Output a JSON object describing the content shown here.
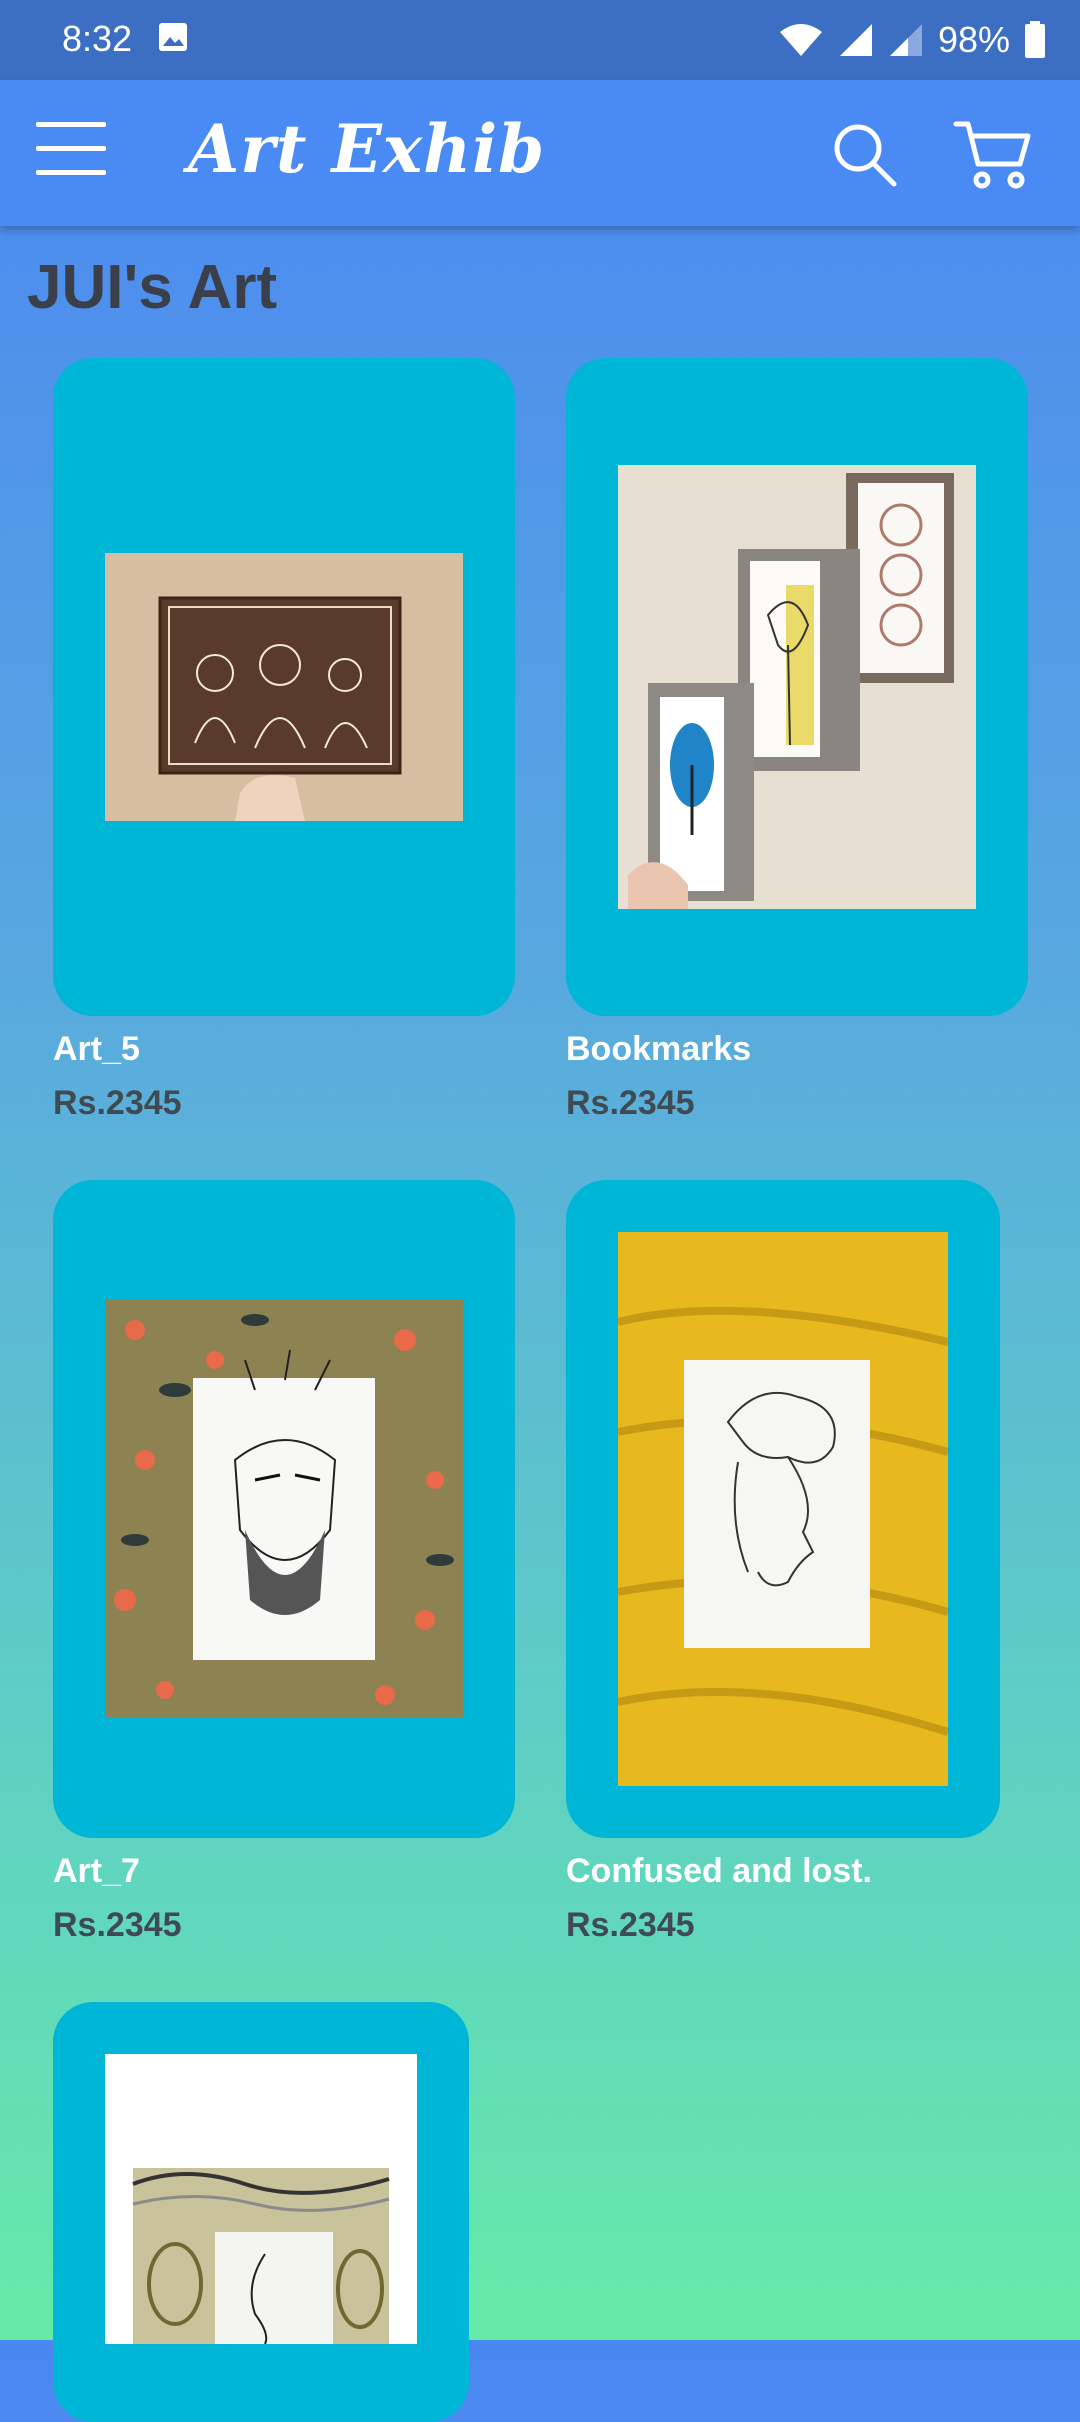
{
  "status_bar": {
    "time": "8:32",
    "battery": "98%"
  },
  "app_bar": {
    "title": "Art Exhib",
    "menu_icon": "menu-icon",
    "search_icon": "search-icon",
    "cart_icon": "cart-icon"
  },
  "section_title": "JUI's Art",
  "products": [
    {
      "name": "Art_5",
      "price": "Rs.2345"
    },
    {
      "name": "Bookmarks",
      "price": "Rs.2345"
    },
    {
      "name": "Art_7",
      "price": "Rs.2345"
    },
    {
      "name": "Confused and lost.",
      "price": "Rs.2345"
    },
    {
      "name": "",
      "price": ""
    }
  ],
  "colors": {
    "card": "#00b6d6",
    "app_bar": "#4a8af5",
    "status_bar": "#3c6ec4"
  }
}
